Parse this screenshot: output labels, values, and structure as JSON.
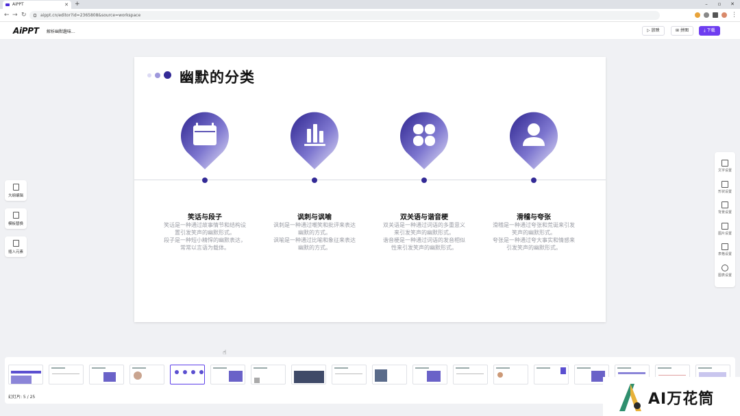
{
  "browser": {
    "tab_title": "AiPPT",
    "url": "aippt.cn/editor?id=2365808&source=workspace"
  },
  "header": {
    "logo": "AiPPT",
    "doc_title": "解析幽默趣味...",
    "play_label": "放映",
    "collage_label": "拼图",
    "download_label": "下载"
  },
  "slide": {
    "title": "幽默的分类",
    "colors": {
      "accent": "#332a96",
      "light": "#c9c6ee"
    },
    "cards": [
      {
        "icon": "calendar-icon",
        "title": "笑话与段子",
        "desc": [
          "笑话是一种通过故事情节和结构设",
          "置引发笑声的幽默形式。",
          "段子是一种短小精悍的幽默表达，",
          "常常以言语为载体。"
        ]
      },
      {
        "icon": "bar-chart-icon",
        "title": "讽刺与讽喻",
        "desc": [
          "讽刺是一种通过嘲笑和批评来表达",
          "幽默的方式。",
          "讽喻是一种通过比喻和象征来表达",
          "幽默的方式。"
        ]
      },
      {
        "icon": "grid-icon",
        "title": "双关语与谐音梗",
        "desc": [
          "双关语是一种通过词语的多重意义",
          "来引发笑声的幽默形式。",
          "谐音梗是一种通过词语的发音相似",
          "性来引发笑声的幽默形式。"
        ]
      },
      {
        "icon": "user-icon",
        "title": "滑稽与夸张",
        "desc": [
          "滑稽是一种通过夸张和荒诞来引发",
          "笑声的幽默形式。",
          "夸张是一种通过夸大事实和情感来",
          "引发笑声的幽默形式。"
        ]
      }
    ]
  },
  "left_tools": [
    {
      "icon": "outline-icon",
      "label": "大纲编辑"
    },
    {
      "icon": "template-icon",
      "label": "模板替换"
    },
    {
      "icon": "insert-icon",
      "label": "插入元素"
    }
  ],
  "right_tools": [
    {
      "icon": "text-icon",
      "label": "文字设置"
    },
    {
      "icon": "shape-icon",
      "label": "形状设置"
    },
    {
      "icon": "background-icon",
      "label": "背景设置"
    },
    {
      "icon": "image-icon",
      "label": "图片设置"
    },
    {
      "icon": "table-icon",
      "label": "表格设置"
    },
    {
      "icon": "chart-icon",
      "label": "图表设置"
    }
  ],
  "thumbnails": {
    "current": 5,
    "total": 25,
    "page_info": "幻灯片: 5 / 25"
  },
  "watermark": {
    "text": "AI万花筒"
  }
}
